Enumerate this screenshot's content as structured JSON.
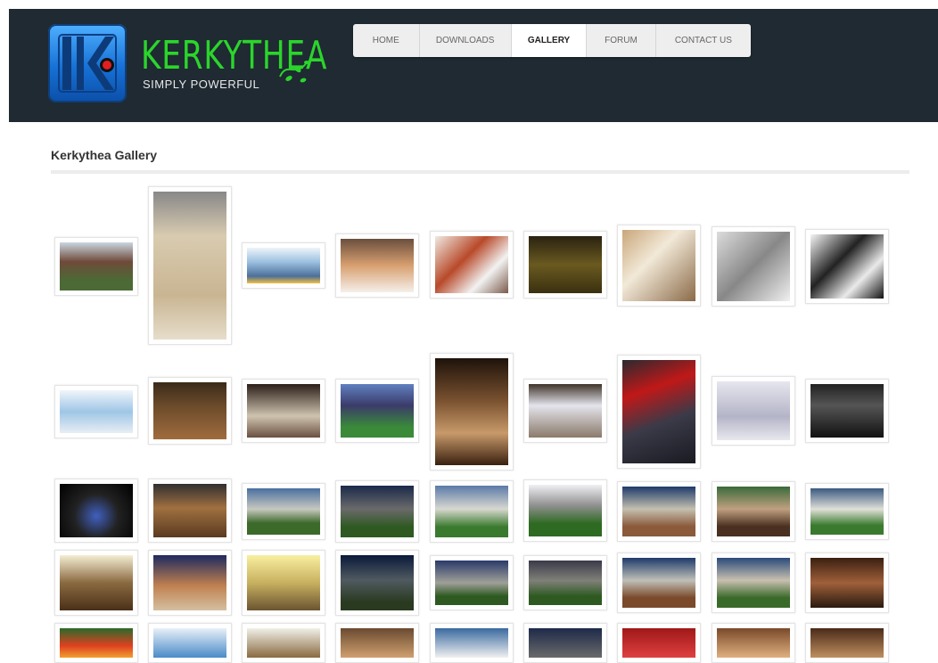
{
  "brand": {
    "name": "KERKYTHEA",
    "tagline": "SIMPLY POWERFUL"
  },
  "nav": {
    "items": [
      {
        "label": "HOME"
      },
      {
        "label": "DOWNLOADS"
      },
      {
        "label": "GALLERY",
        "active": true
      },
      {
        "label": "FORUM"
      },
      {
        "label": "CONTACT US"
      }
    ]
  },
  "gallery": {
    "title": "Kerkythea Gallery"
  },
  "colors": {
    "header": "#1f2a32",
    "brand_green": "#2bd52b",
    "nav_bg": "#eeeeee"
  }
}
